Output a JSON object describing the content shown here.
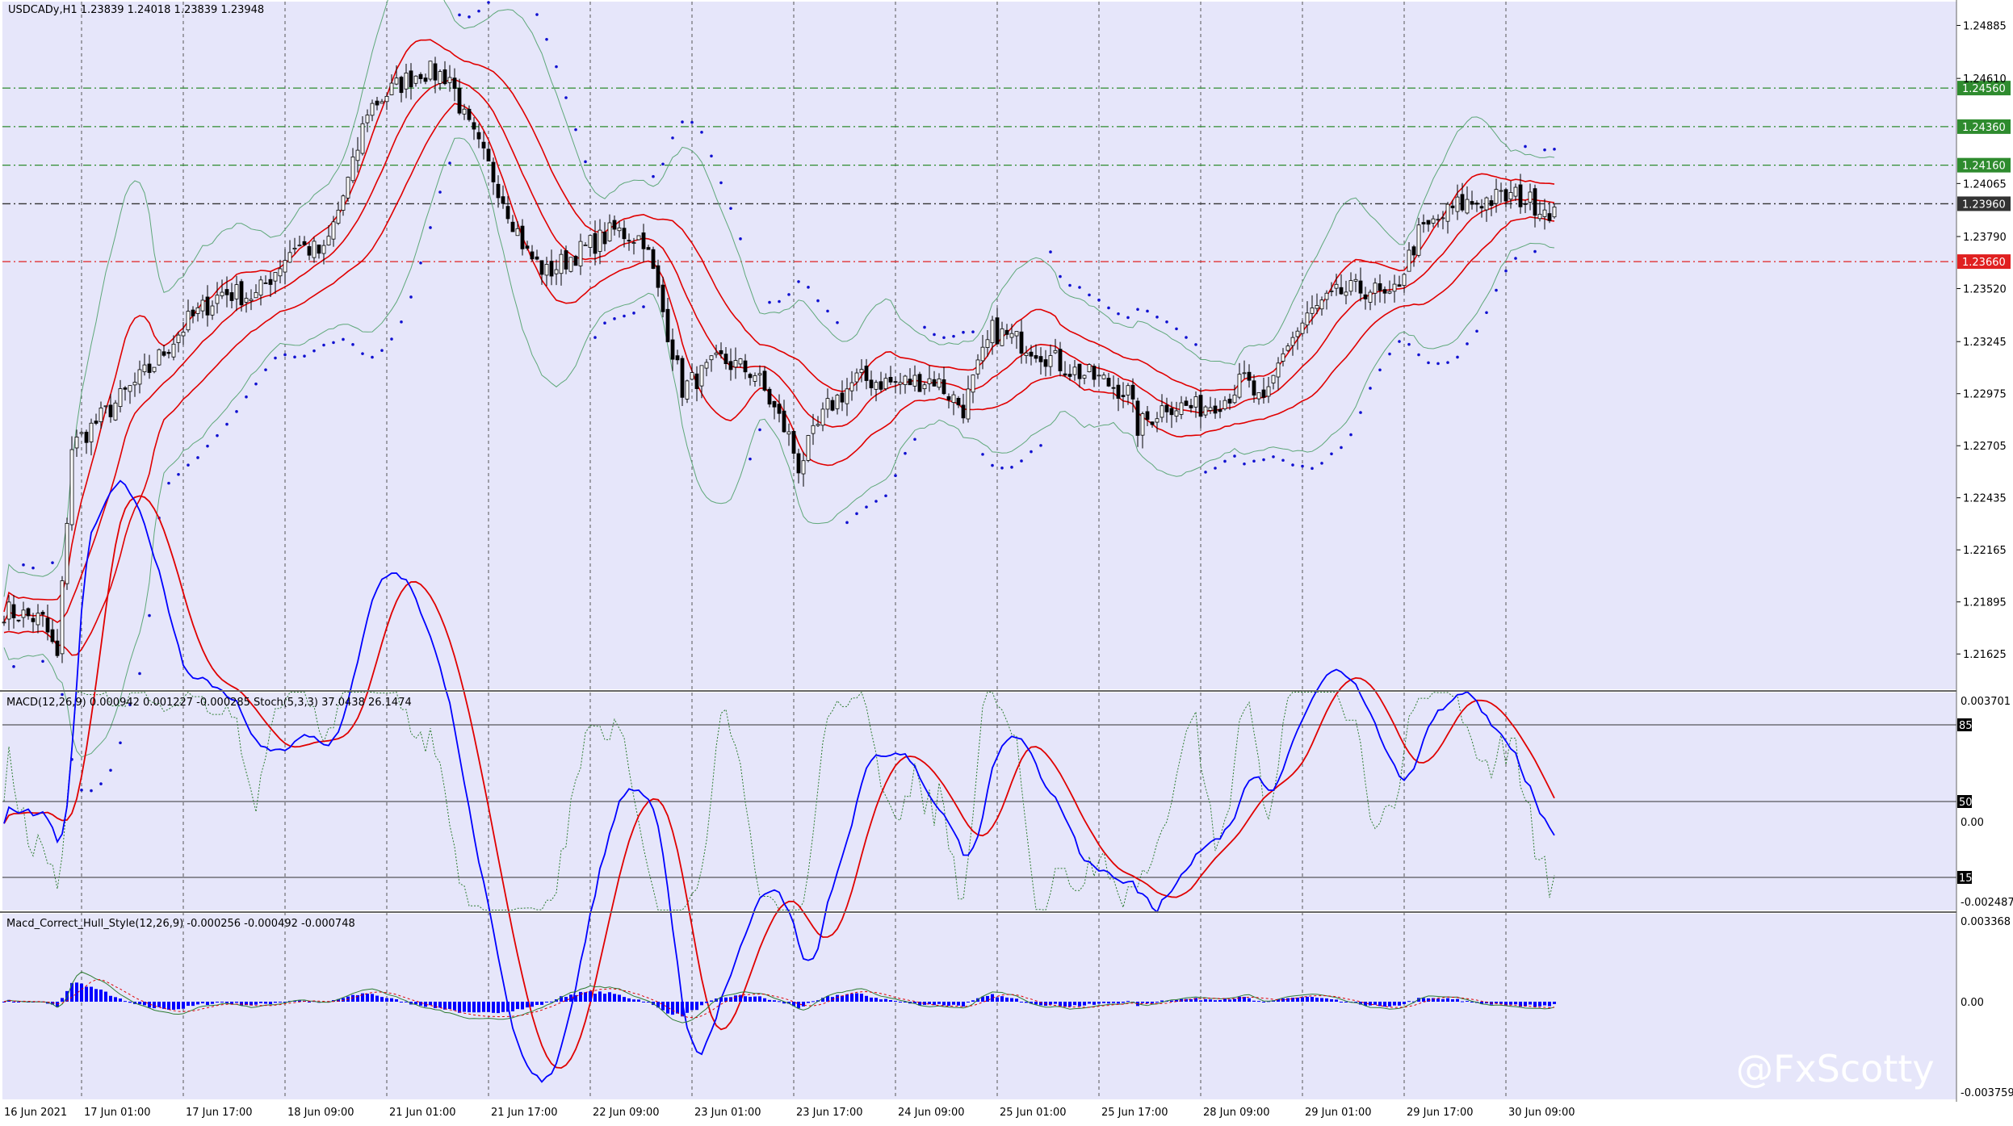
{
  "chart_data": {
    "type": "candlestick",
    "symbol_header": "USDCADy,H1  1.23839 1.24018 1.23839 1.23948",
    "ylim": [
      1.2145,
      1.25
    ],
    "x_ticks": [
      "16 Jun 2021",
      "17 Jun 01:00",
      "17 Jun 17:00",
      "18 Jun 09:00",
      "21 Jun 01:00",
      "21 Jun 17:00",
      "22 Jun 09:00",
      "23 Jun 01:00",
      "23 Jun 17:00",
      "24 Jun 09:00",
      "25 Jun 01:00",
      "25 Jun 17:00",
      "28 Jun 09:00",
      "29 Jun 01:00",
      "29 Jun 17:00",
      "30 Jun 09:00"
    ],
    "y_ticks": [
      "1.24885",
      "1.24610",
      "1.24065",
      "1.23790",
      "1.23520",
      "1.23245",
      "1.22975",
      "1.22705",
      "1.22435",
      "1.22165",
      "1.21895",
      "1.21625"
    ],
    "y_tick_values": [
      1.24885,
      1.2461,
      1.24065,
      1.2379,
      1.2352,
      1.23245,
      1.22975,
      1.22705,
      1.22435,
      1.22165,
      1.21895,
      1.21625
    ],
    "horizontal_levels": [
      {
        "price": 1.2456,
        "label": "1.24560",
        "color": "#2e8b2e",
        "style": "dashdot"
      },
      {
        "price": 1.2436,
        "label": "1.24360",
        "color": "#2e8b2e",
        "style": "dashdot"
      },
      {
        "price": 1.2416,
        "label": "1.24160",
        "color": "#2e8b2e",
        "style": "dashdot"
      },
      {
        "price": 1.2396,
        "label": "1.23960",
        "color": "#333333",
        "style": "dashdot"
      },
      {
        "price": 1.2366,
        "label": "1.23660",
        "color": "#e02020",
        "style": "dashdot"
      }
    ],
    "close_anchors": [
      [
        0,
        1.2185
      ],
      [
        8,
        1.218
      ],
      [
        11,
        1.216
      ],
      [
        14,
        1.227
      ],
      [
        22,
        1.229
      ],
      [
        30,
        1.231
      ],
      [
        38,
        1.2335
      ],
      [
        45,
        1.235
      ],
      [
        52,
        1.2348
      ],
      [
        60,
        1.2375
      ],
      [
        66,
        1.237
      ],
      [
        72,
        1.2415
      ],
      [
        75,
        1.2445
      ],
      [
        80,
        1.2455
      ],
      [
        86,
        1.2465
      ],
      [
        92,
        1.2462
      ],
      [
        95,
        1.244
      ],
      [
        102,
        1.2405
      ],
      [
        108,
        1.237
      ],
      [
        112,
        1.236
      ],
      [
        118,
        1.237
      ],
      [
        126,
        1.2382
      ],
      [
        132,
        1.2378
      ],
      [
        134,
        1.236
      ],
      [
        140,
        1.23
      ],
      [
        148,
        1.2315
      ],
      [
        155,
        1.2308
      ],
      [
        162,
        1.2275
      ],
      [
        164,
        1.226
      ],
      [
        170,
        1.229
      ],
      [
        176,
        1.2305
      ],
      [
        184,
        1.2303
      ],
      [
        192,
        1.2305
      ],
      [
        198,
        1.229
      ],
      [
        204,
        1.233
      ],
      [
        212,
        1.2322
      ],
      [
        220,
        1.231
      ],
      [
        226,
        1.2305
      ],
      [
        232,
        1.2298
      ],
      [
        234,
        1.228
      ],
      [
        240,
        1.2292
      ],
      [
        246,
        1.229
      ],
      [
        252,
        1.2295
      ],
      [
        256,
        1.2305
      ],
      [
        260,
        1.229
      ],
      [
        264,
        1.232
      ],
      [
        270,
        1.234
      ],
      [
        276,
        1.235
      ],
      [
        282,
        1.2352
      ],
      [
        286,
        1.2345
      ],
      [
        292,
        1.238
      ],
      [
        300,
        1.2395
      ],
      [
        306,
        1.2398
      ],
      [
        312,
        1.24
      ],
      [
        316,
        1.2396
      ],
      [
        320,
        1.2392
      ]
    ],
    "bars": 321,
    "indicators": {
      "bollinger": {
        "color_mid": "#e00000",
        "color_outer": "#5fa87a"
      },
      "envelope": {
        "color": "#e00000"
      },
      "parabolic_sar": {
        "color": "#1010d0"
      }
    },
    "panels": [
      {
        "name": "MACD(12,26,9) 0.000942 0.001227 -0.000285  Stoch(5,3,3) 37.0438 26.1474",
        "right_labels": [
          "0.003701",
          "0.00",
          "-0.002487"
        ],
        "levels": [
          "85",
          "50",
          "15"
        ],
        "series_colors": {
          "macd": "#0000ff",
          "signal": "#e00000",
          "stoch": "#2e7d32"
        }
      },
      {
        "name": "Macd_Correct_Hull_Style(12,26,9) -0.000256 -0.000492 -0.000748",
        "right_labels": [
          "0.003368",
          "0.00",
          "-0.003759"
        ],
        "series_colors": {
          "histogram": "#0000ff",
          "line": "#2e7d32",
          "signal": "#e00000"
        }
      }
    ]
  },
  "watermark": "@FxScotty",
  "colors": {
    "background": "#e6e6fa",
    "grid": "#555555",
    "axis_bg": "#ffffff"
  }
}
